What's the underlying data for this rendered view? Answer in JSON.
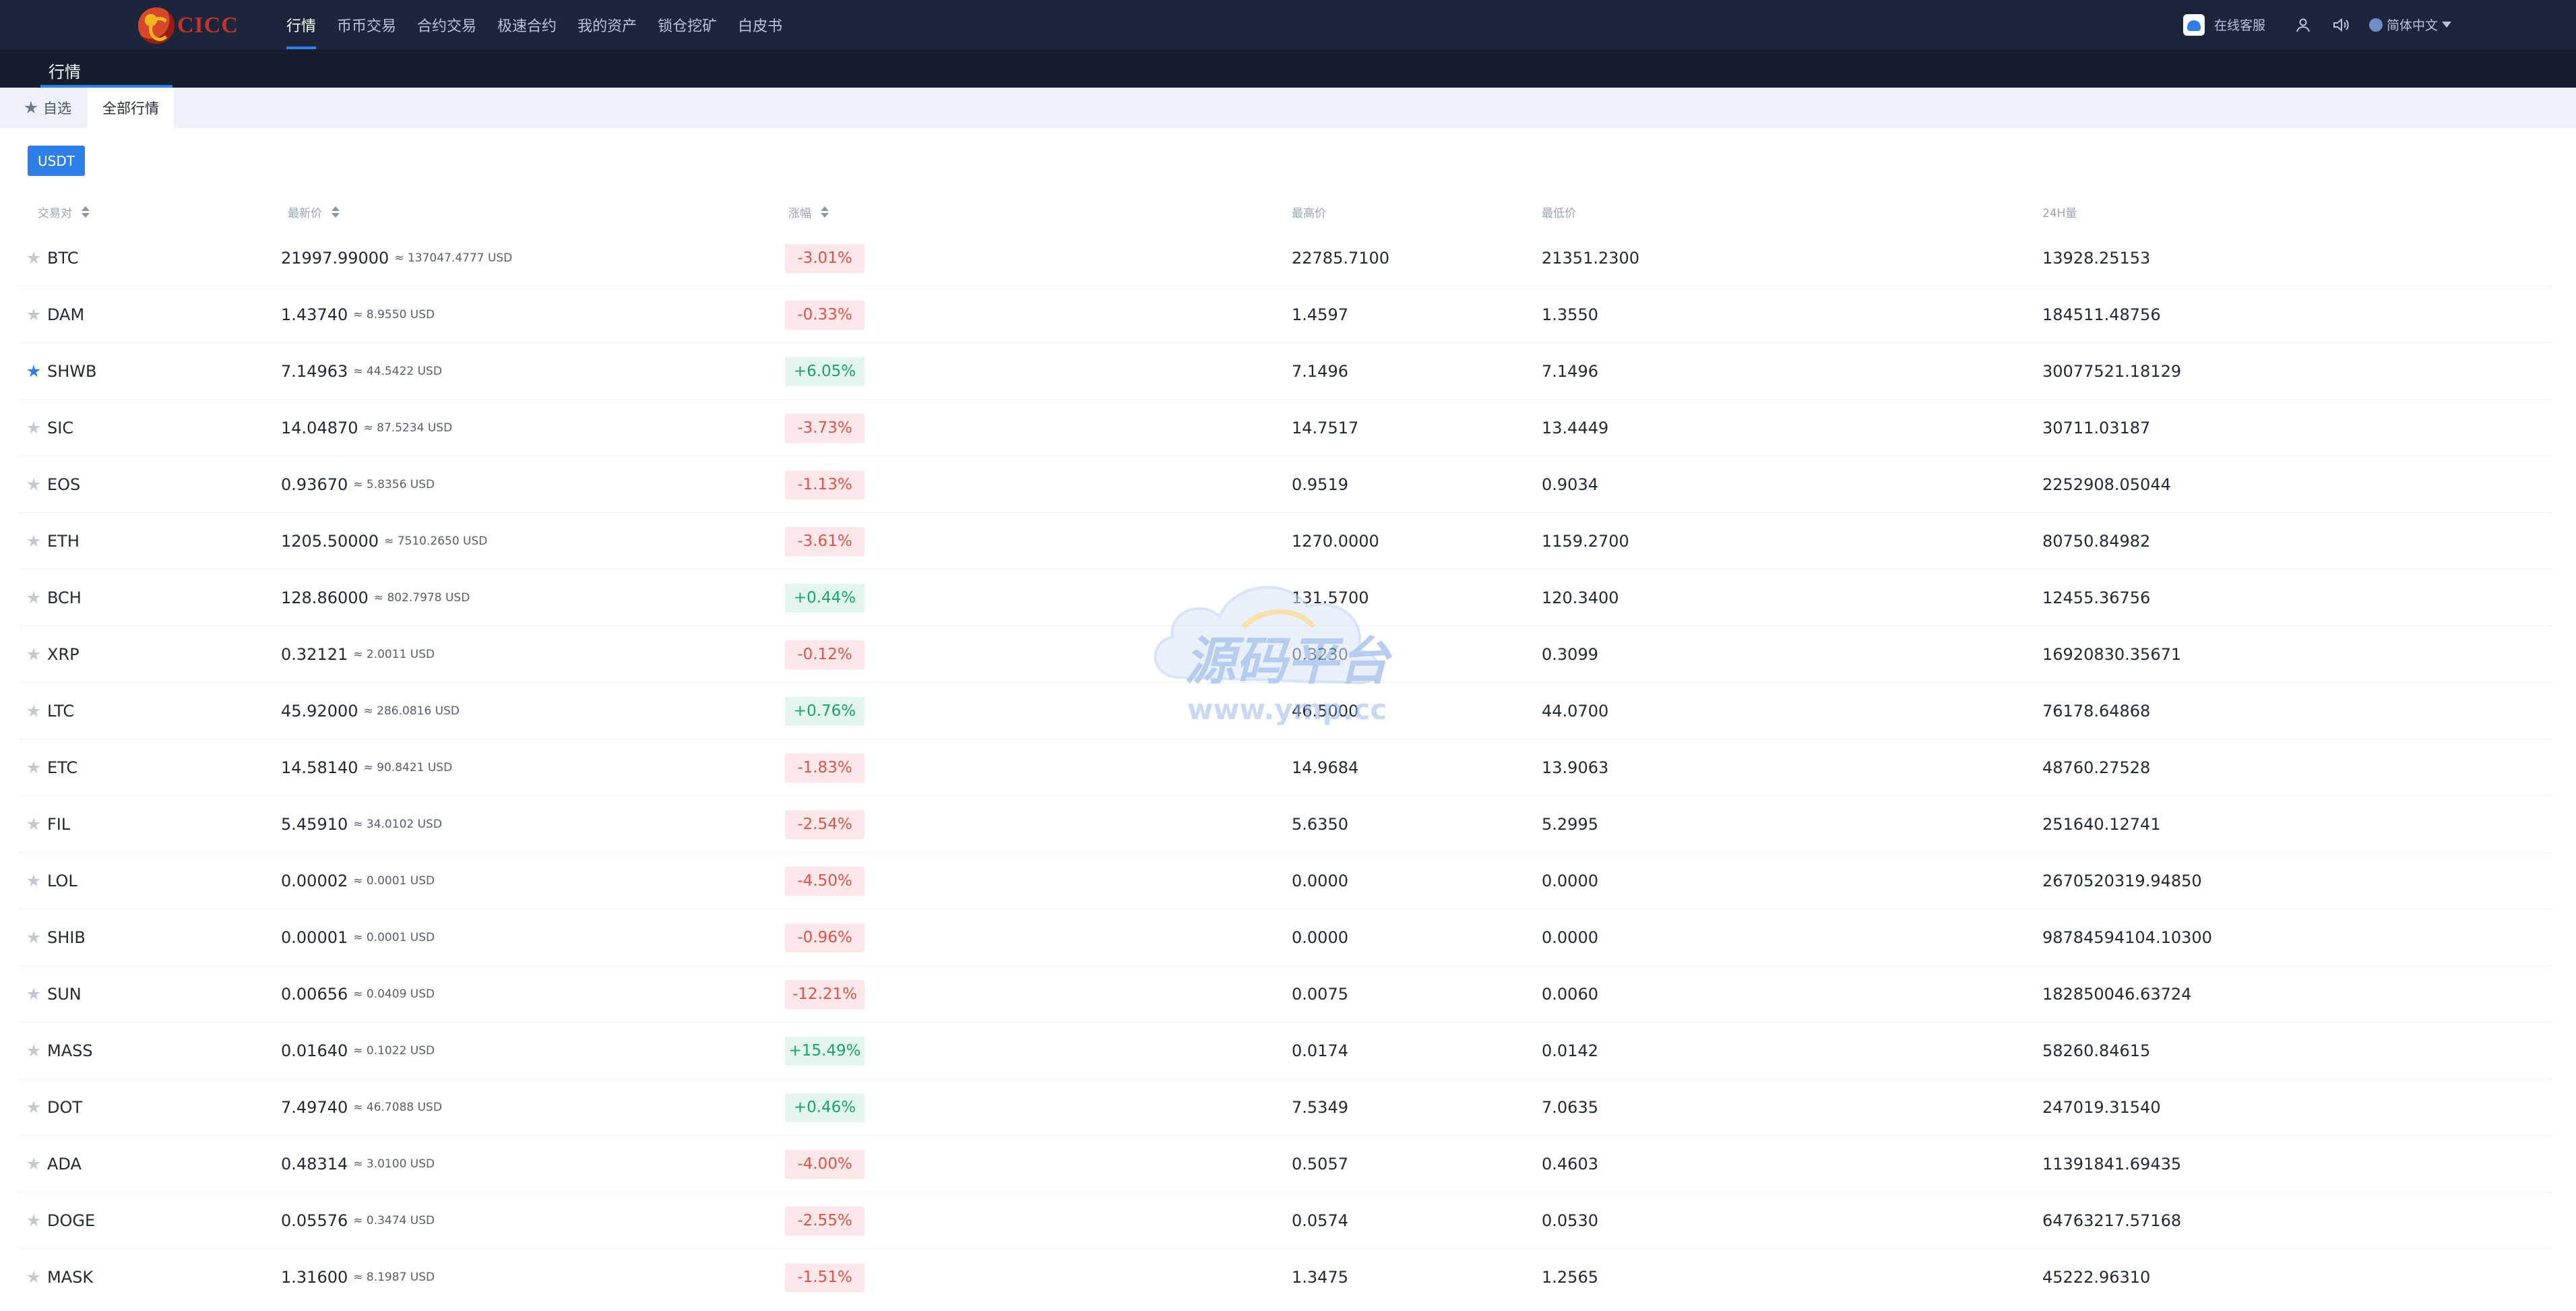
{
  "brand": {
    "logo_text": "CICC"
  },
  "nav": {
    "items": [
      {
        "label": "行情",
        "active": true
      },
      {
        "label": "币币交易",
        "active": false
      },
      {
        "label": "合约交易",
        "active": false
      },
      {
        "label": "极速合约",
        "active": false
      },
      {
        "label": "我的资产",
        "active": false
      },
      {
        "label": "锁仓挖矿",
        "active": false
      },
      {
        "label": "白皮书",
        "active": false
      }
    ],
    "support_label": "在线客服",
    "language_label": "简体中文"
  },
  "page": {
    "title": "行情"
  },
  "tabs": {
    "favorites": "自选",
    "all": "全部行情"
  },
  "quote_currency": "USDT",
  "table": {
    "headers": {
      "pair": "交易对",
      "last_price": "最新价",
      "change": "涨幅",
      "high": "最高价",
      "low": "最低价",
      "volume": "24H量"
    },
    "rows": [
      {
        "symbol": "BTC",
        "favorite": false,
        "price": "21997.99000",
        "approx": "≈ 137047.4777 USD",
        "change": "-3.01%",
        "direction": "down",
        "high": "22785.7100",
        "low": "21351.2300",
        "volume": "13928.25153"
      },
      {
        "symbol": "DAM",
        "favorite": false,
        "price": "1.43740",
        "approx": "≈ 8.9550 USD",
        "change": "-0.33%",
        "direction": "down",
        "high": "1.4597",
        "low": "1.3550",
        "volume": "184511.48756"
      },
      {
        "symbol": "SHWB",
        "favorite": true,
        "price": "7.14963",
        "approx": "≈ 44.5422 USD",
        "change": "+6.05%",
        "direction": "up",
        "high": "7.1496",
        "low": "7.1496",
        "volume": "30077521.18129"
      },
      {
        "symbol": "SIC",
        "favorite": false,
        "price": "14.04870",
        "approx": "≈ 87.5234 USD",
        "change": "-3.73%",
        "direction": "down",
        "high": "14.7517",
        "low": "13.4449",
        "volume": "30711.03187"
      },
      {
        "symbol": "EOS",
        "favorite": false,
        "price": "0.93670",
        "approx": "≈ 5.8356 USD",
        "change": "-1.13%",
        "direction": "down",
        "high": "0.9519",
        "low": "0.9034",
        "volume": "2252908.05044"
      },
      {
        "symbol": "ETH",
        "favorite": false,
        "price": "1205.50000",
        "approx": "≈ 7510.2650 USD",
        "change": "-3.61%",
        "direction": "down",
        "high": "1270.0000",
        "low": "1159.2700",
        "volume": "80750.84982"
      },
      {
        "symbol": "BCH",
        "favorite": false,
        "price": "128.86000",
        "approx": "≈ 802.7978 USD",
        "change": "+0.44%",
        "direction": "up",
        "high": "131.5700",
        "low": "120.3400",
        "volume": "12455.36756"
      },
      {
        "symbol": "XRP",
        "favorite": false,
        "price": "0.32121",
        "approx": "≈ 2.0011 USD",
        "change": "-0.12%",
        "direction": "down",
        "high": "0.3230",
        "low": "0.3099",
        "volume": "16920830.35671"
      },
      {
        "symbol": "LTC",
        "favorite": false,
        "price": "45.92000",
        "approx": "≈ 286.0816 USD",
        "change": "+0.76%",
        "direction": "up",
        "high": "46.5000",
        "low": "44.0700",
        "volume": "76178.64868"
      },
      {
        "symbol": "ETC",
        "favorite": false,
        "price": "14.58140",
        "approx": "≈ 90.8421 USD",
        "change": "-1.83%",
        "direction": "down",
        "high": "14.9684",
        "low": "13.9063",
        "volume": "48760.27528"
      },
      {
        "symbol": "FIL",
        "favorite": false,
        "price": "5.45910",
        "approx": "≈ 34.0102 USD",
        "change": "-2.54%",
        "direction": "down",
        "high": "5.6350",
        "low": "5.2995",
        "volume": "251640.12741"
      },
      {
        "symbol": "LOL",
        "favorite": false,
        "price": "0.00002",
        "approx": "≈ 0.0001 USD",
        "change": "-4.50%",
        "direction": "down",
        "high": "0.0000",
        "low": "0.0000",
        "volume": "2670520319.94850"
      },
      {
        "symbol": "SHIB",
        "favorite": false,
        "price": "0.00001",
        "approx": "≈ 0.0001 USD",
        "change": "-0.96%",
        "direction": "down",
        "high": "0.0000",
        "low": "0.0000",
        "volume": "98784594104.10300"
      },
      {
        "symbol": "SUN",
        "favorite": false,
        "price": "0.00656",
        "approx": "≈ 0.0409 USD",
        "change": "-12.21%",
        "direction": "down",
        "high": "0.0075",
        "low": "0.0060",
        "volume": "182850046.63724"
      },
      {
        "symbol": "MASS",
        "favorite": false,
        "price": "0.01640",
        "approx": "≈ 0.1022 USD",
        "change": "+15.49%",
        "direction": "up",
        "high": "0.0174",
        "low": "0.0142",
        "volume": "58260.84615"
      },
      {
        "symbol": "DOT",
        "favorite": false,
        "price": "7.49740",
        "approx": "≈ 46.7088 USD",
        "change": "+0.46%",
        "direction": "up",
        "high": "7.5349",
        "low": "7.0635",
        "volume": "247019.31540"
      },
      {
        "symbol": "ADA",
        "favorite": false,
        "price": "0.48314",
        "approx": "≈ 3.0100 USD",
        "change": "-4.00%",
        "direction": "down",
        "high": "0.5057",
        "low": "0.4603",
        "volume": "11391841.69435"
      },
      {
        "symbol": "DOGE",
        "favorite": false,
        "price": "0.05576",
        "approx": "≈ 0.3474 USD",
        "change": "-2.55%",
        "direction": "down",
        "high": "0.0574",
        "low": "0.0530",
        "volume": "64763217.57168"
      },
      {
        "symbol": "MASK",
        "favorite": false,
        "price": "1.31600",
        "approx": "≈ 8.1987 USD",
        "change": "-1.51%",
        "direction": "down",
        "high": "1.3475",
        "low": "1.2565",
        "volume": "45222.96310"
      }
    ]
  },
  "watermark": {
    "text": "源码平台",
    "url": "www.ymp.cc"
  },
  "colors": {
    "nav_bg": "#1c2539",
    "accent": "#2f7fe8",
    "up": "#1aa36f",
    "down": "#e0534a"
  }
}
